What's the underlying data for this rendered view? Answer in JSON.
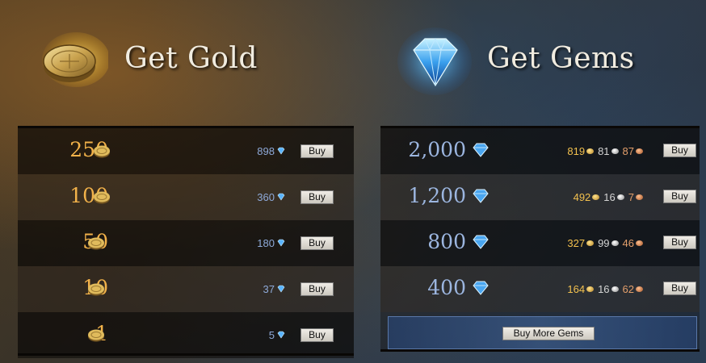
{
  "gold_section": {
    "title": "Get Gold",
    "icon": "gold-coin-icon",
    "rows": [
      {
        "amount": "250",
        "price": "898",
        "buy_label": "Buy"
      },
      {
        "amount": "100",
        "price": "360",
        "buy_label": "Buy"
      },
      {
        "amount": "50",
        "price": "180",
        "buy_label": "Buy"
      },
      {
        "amount": "10",
        "price": "37",
        "buy_label": "Buy"
      },
      {
        "amount": "1",
        "price": "5",
        "buy_label": "Buy"
      }
    ]
  },
  "gems_section": {
    "title": "Get Gems",
    "icon": "blue-gem-icon",
    "rows": [
      {
        "amount": "2,000",
        "gold": "819",
        "silver": "81",
        "copper": "87",
        "buy_label": "Buy"
      },
      {
        "amount": "1,200",
        "gold": "492",
        "silver": "16",
        "copper": "7",
        "buy_label": "Buy"
      },
      {
        "amount": "800",
        "gold": "327",
        "silver": "99",
        "copper": "46",
        "buy_label": "Buy"
      },
      {
        "amount": "400",
        "gold": "164",
        "silver": "16",
        "copper": "62",
        "buy_label": "Buy"
      }
    ],
    "more_button_label": "Buy More Gems"
  },
  "colors": {
    "gold_text": "#f2b24a",
    "gem_text": "#9cb6e0",
    "price_blue": "#8ea9d8",
    "title_text": "#f1ece0"
  }
}
